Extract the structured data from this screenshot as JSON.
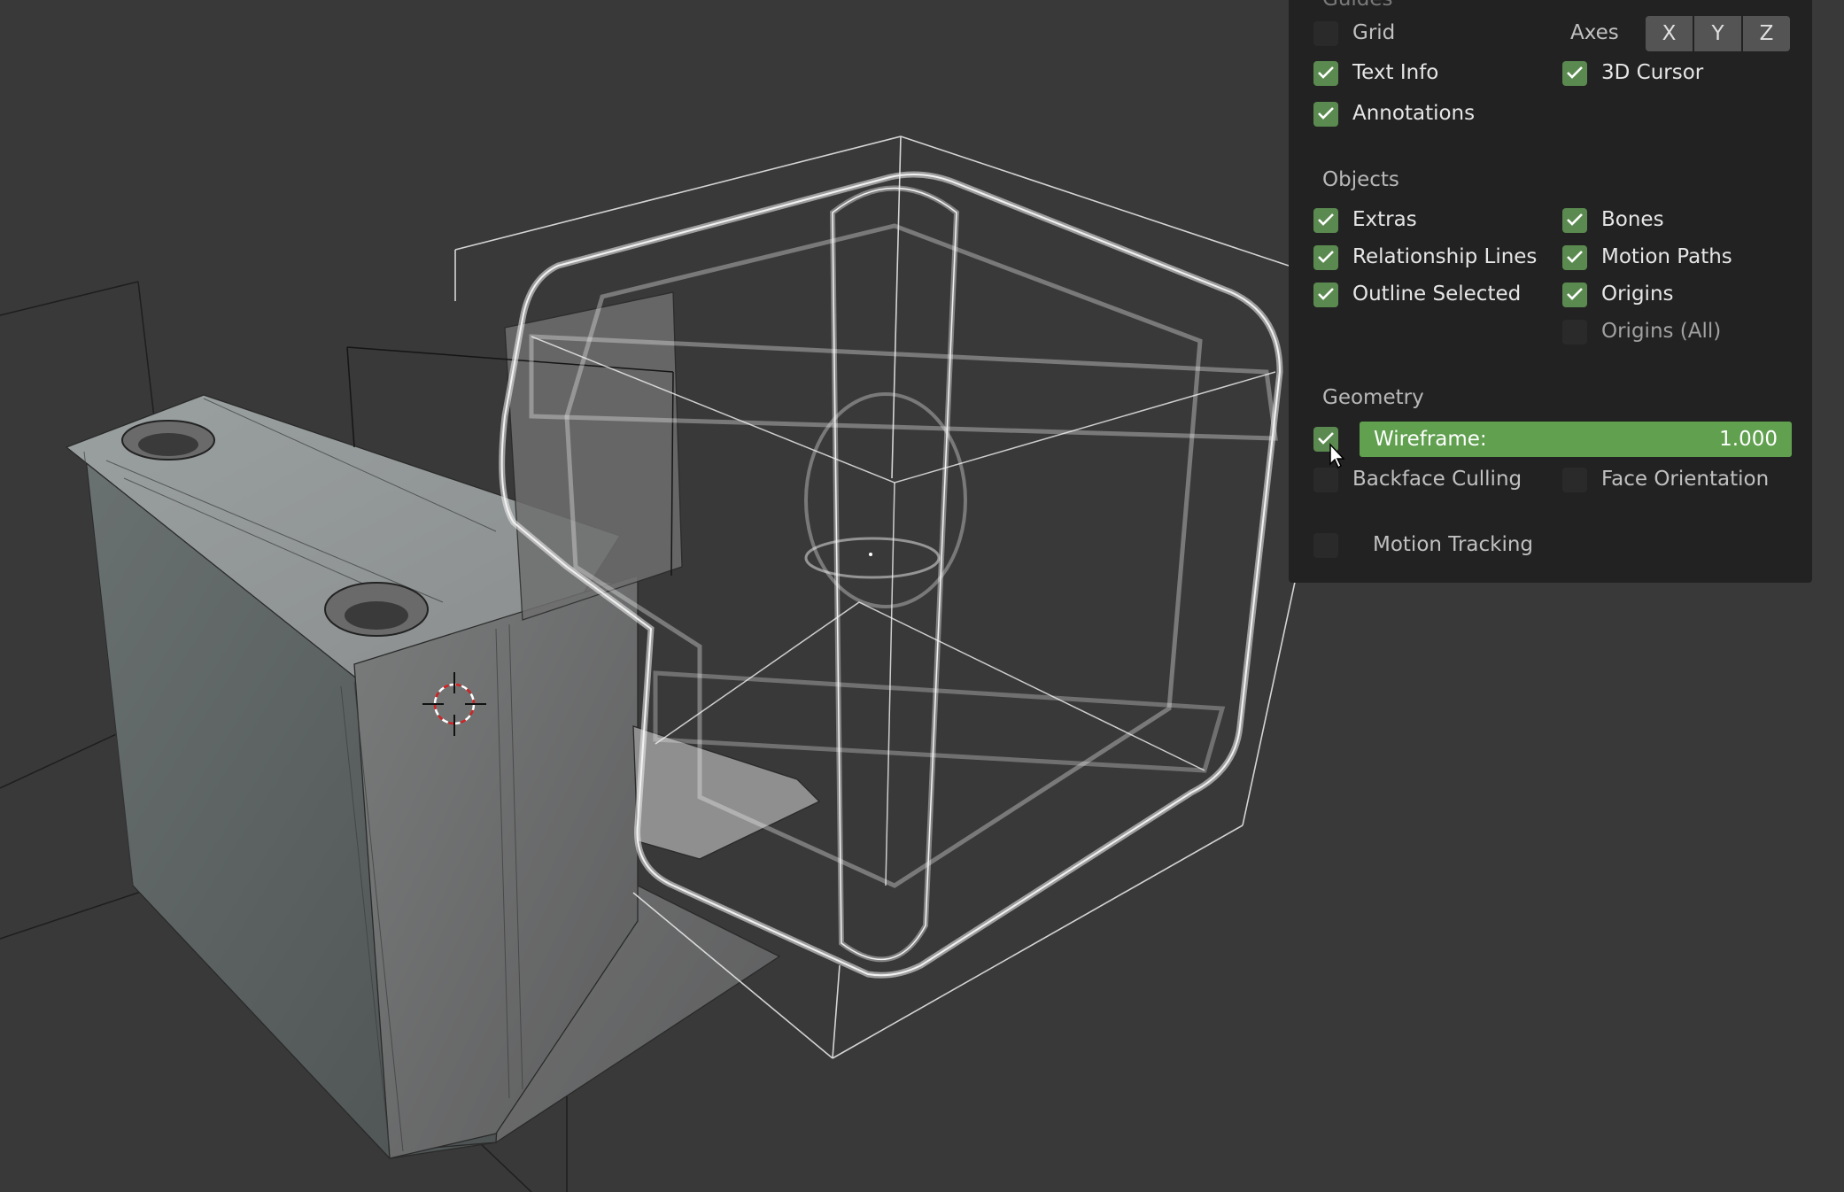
{
  "overlays": {
    "guides": {
      "title": "Guides",
      "grid_label": "Grid",
      "axes_label": "Axes",
      "axis_x": "X",
      "axis_y": "Y",
      "axis_z": "Z",
      "text_info_label": "Text Info",
      "cursor_3d_label": "3D Cursor",
      "annotations_label": "Annotations"
    },
    "objects": {
      "title": "Objects",
      "extras_label": "Extras",
      "bones_label": "Bones",
      "relationship_lines_label": "Relationship Lines",
      "motion_paths_label": "Motion Paths",
      "outline_selected_label": "Outline Selected",
      "origins_label": "Origins",
      "origins_all_label": "Origins (All)"
    },
    "geometry": {
      "title": "Geometry",
      "wireframe_label": "Wireframe:",
      "wireframe_value": "1.000",
      "backface_culling_label": "Backface Culling",
      "face_orientation_label": "Face Orientation"
    },
    "motion_tracking_label": "Motion Tracking"
  },
  "states": {
    "grid": false,
    "text_info": true,
    "cursor_3d": true,
    "annotations": true,
    "extras": true,
    "bones": true,
    "relationship_lines": true,
    "motion_paths": true,
    "outline_selected": true,
    "origins": true,
    "origins_all": false,
    "wireframe": true,
    "backface_culling": false,
    "face_orientation": false,
    "motion_tracking": false
  },
  "colors": {
    "viewport_bg": "#393939",
    "panel_bg": "#222222",
    "checkbox_checked": "#5a8a4f",
    "slider_fill": "#60a04f"
  },
  "icons": [
    "checkmark-icon",
    "mouse-cursor-icon",
    "3d-cursor-icon"
  ]
}
